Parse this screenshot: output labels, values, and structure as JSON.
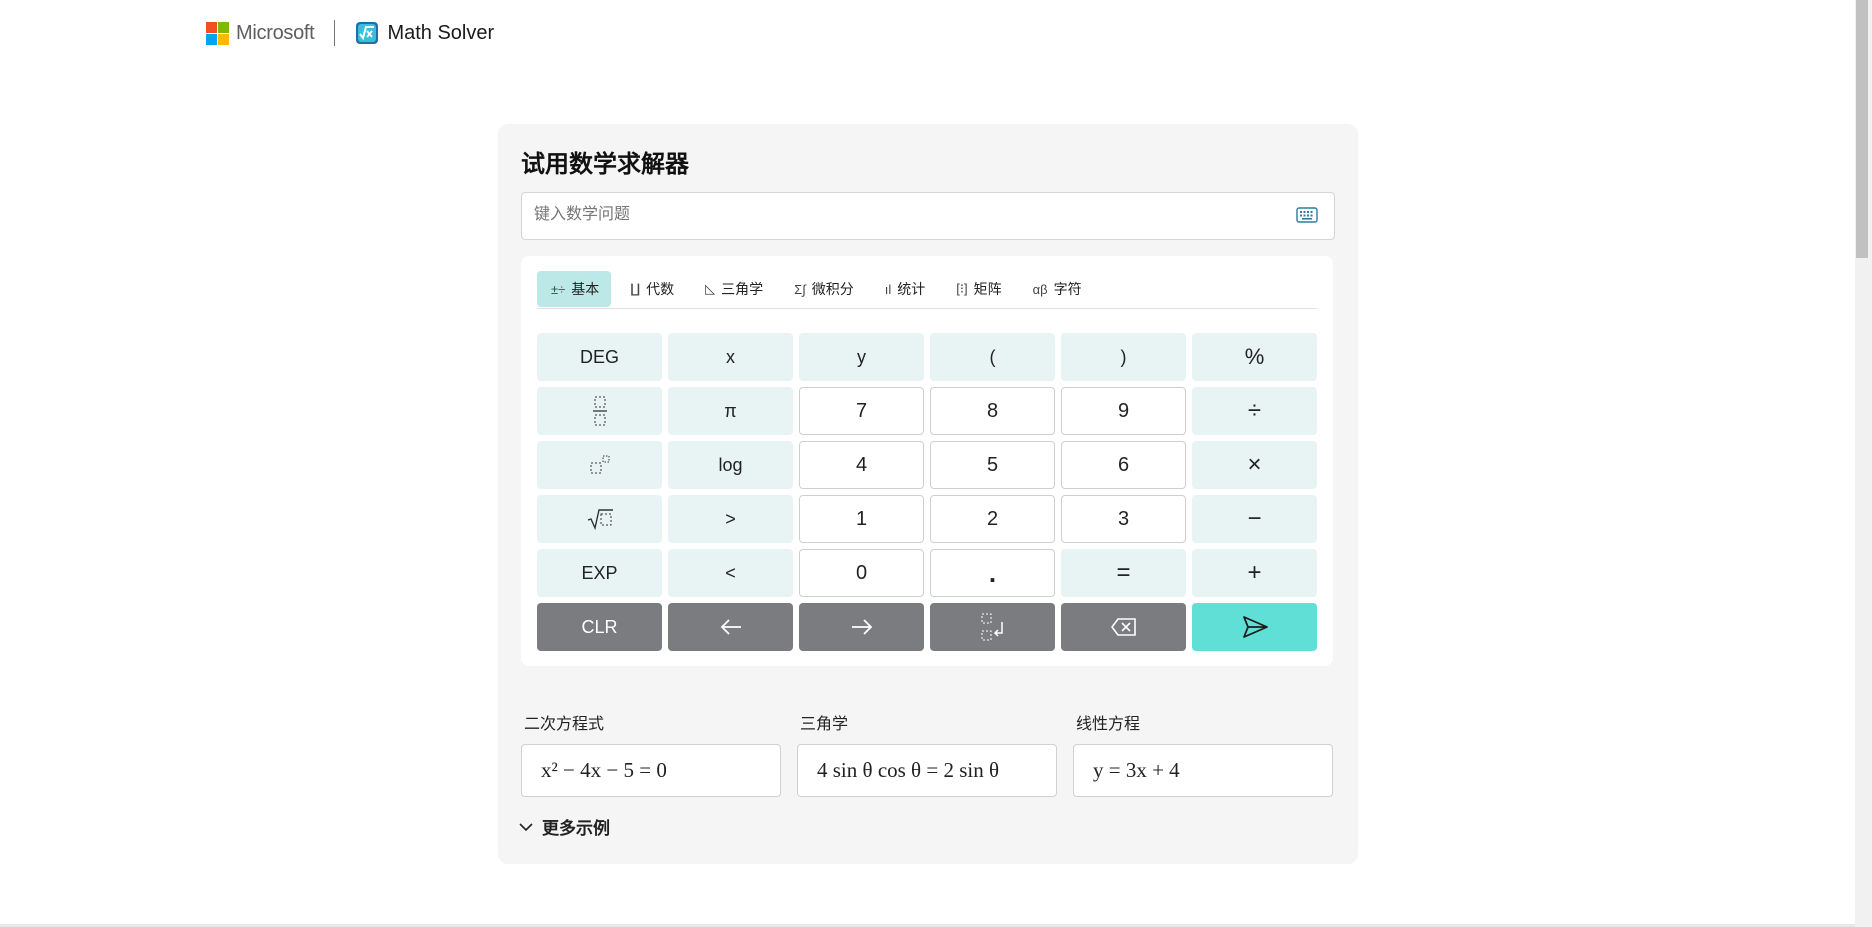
{
  "header": {
    "brand": "Microsoft",
    "product": "Math Solver",
    "logo_colors": [
      "#f25022",
      "#7fba00",
      "#00a4ef",
      "#ffb900"
    ]
  },
  "card": {
    "title": "试用数学求解器",
    "input_placeholder": "键入数学问题",
    "input_value": ""
  },
  "tabs": [
    {
      "label": "基本",
      "icon": "basic-icon",
      "active": true
    },
    {
      "label": "代数",
      "icon": "algebra-icon",
      "active": false
    },
    {
      "label": "三角学",
      "icon": "trigonometry-icon",
      "active": false
    },
    {
      "label": "微积分",
      "icon": "calculus-icon",
      "active": false
    },
    {
      "label": "统计",
      "icon": "statistics-icon",
      "active": false
    },
    {
      "label": "矩阵",
      "icon": "matrix-icon",
      "active": false
    },
    {
      "label": "字符",
      "icon": "characters-icon",
      "active": false
    }
  ],
  "keys": {
    "r1": [
      "DEG",
      "x",
      "y",
      "(",
      ")",
      "%"
    ],
    "r2_pi": "π",
    "r2_nums": [
      "7",
      "8",
      "9"
    ],
    "r2_op": "÷",
    "r3_log": "log",
    "r3_nums": [
      "4",
      "5",
      "6"
    ],
    "r3_op": "×",
    "r4_gt": ">",
    "r4_nums": [
      "1",
      "2",
      "3"
    ],
    "r4_op": "−",
    "r5": [
      "EXP",
      "<",
      "0",
      ".",
      "=",
      "+"
    ],
    "clr": "CLR"
  },
  "examples": [
    {
      "label": "二次方程式",
      "expr": "x² − 4x − 5 = 0"
    },
    {
      "label": "三角学",
      "expr": "4 sin θ cos θ = 2 sin θ"
    },
    {
      "label": "线性方程",
      "expr": "y = 3x + 4"
    }
  ],
  "more_examples": "更多示例",
  "colors": {
    "accent": "#5fdfd6",
    "tab_active": "#bde8e8",
    "key_function": "#e8f4f4",
    "key_dark": "#7a7c80"
  }
}
